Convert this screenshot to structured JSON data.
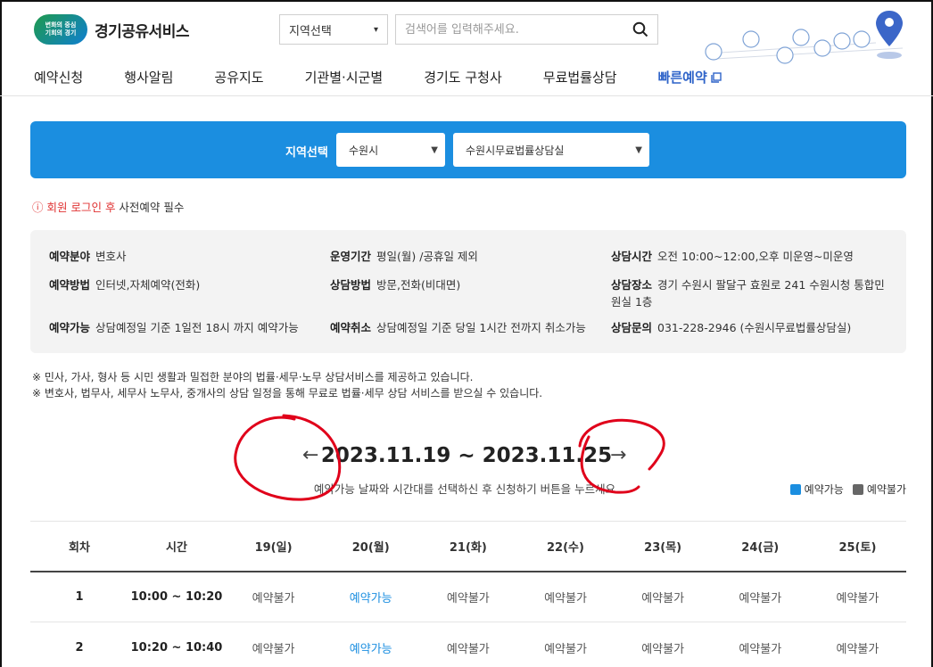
{
  "header": {
    "logo_line1": "변화의 중심",
    "logo_line2": "기회의 경기",
    "site_name": "경기공유서비스",
    "region_select": "지역선택",
    "search_placeholder": "검색어를 입력해주세요."
  },
  "nav": {
    "items": [
      "예약신청",
      "행사알림",
      "공유지도",
      "기관별·시군별",
      "경기도 구청사",
      "무료법률상담"
    ],
    "quick": "빠른예약"
  },
  "filter": {
    "label": "지역선택",
    "city": "수원시",
    "center": "수원시무료법률상담실"
  },
  "notice": {
    "red": "회원 로그인 후",
    "rest": " 사전예약 필수"
  },
  "info": {
    "field": {
      "label": "예약분야",
      "value": "변호사"
    },
    "period": {
      "label": "운영기간",
      "value": "평일(월) /공휴일 제외"
    },
    "hours": {
      "label": "상담시간",
      "value": "오전 10:00~12:00,오후 미운영~미운영"
    },
    "method": {
      "label": "예약방법",
      "value": "인터넷,자체예약(전화)"
    },
    "consult": {
      "label": "상담방법",
      "value": "방문,전화(비대면)"
    },
    "place": {
      "label": "상담장소",
      "value": "경기 수원시 팔달구 효원로 241 수원시청 통합민원실 1층"
    },
    "avail": {
      "label": "예약가능",
      "value": "상담예정일 기준 1일전 18시 까지 예약가능"
    },
    "cancel": {
      "label": "예약취소",
      "value": "상담예정일 기준 당일 1시간 전까지 취소가능"
    },
    "contact": {
      "label": "상담문의",
      "value": "031-228-2946 (수원시무료법률상담실)"
    }
  },
  "desc": {
    "line1": "※ 민사, 가사, 형사 등 시민 생활과 밀접한 분야의 법률·세무·노무 상담서비스를 제공하고 있습니다.",
    "line2": "※ 변호사, 법무사, 세무사 노무사, 중개사의 상담 일정을 통해 무료로 법률·세무 상담 서비스를 받으실 수 있습니다."
  },
  "week": {
    "range": "2023.11.19 ~ 2023.11.25",
    "prev": "←",
    "next": "→",
    "help": "예약가능 날짜와 시간대를 선택하신 후 신청하기 버튼을 누르세요."
  },
  "legend": {
    "available": "예약가능",
    "unavailable": "예약불가",
    "available_color": "#1b8ee0",
    "unavailable_color": "#666666"
  },
  "table": {
    "headers": [
      "회차",
      "시간",
      "19(일)",
      "20(월)",
      "21(화)",
      "22(수)",
      "23(목)",
      "24(금)",
      "25(토)"
    ],
    "rows": [
      {
        "no": "1",
        "time": "10:00 ~ 10:20",
        "cells": [
          "예약불가",
          "예약가능",
          "예약불가",
          "예약불가",
          "예약불가",
          "예약불가",
          "예약불가"
        ]
      },
      {
        "no": "2",
        "time": "10:20 ~ 10:40",
        "cells": [
          "예약불가",
          "예약가능",
          "예약불가",
          "예약불가",
          "예약불가",
          "예약불가",
          "예약불가"
        ]
      }
    ]
  }
}
